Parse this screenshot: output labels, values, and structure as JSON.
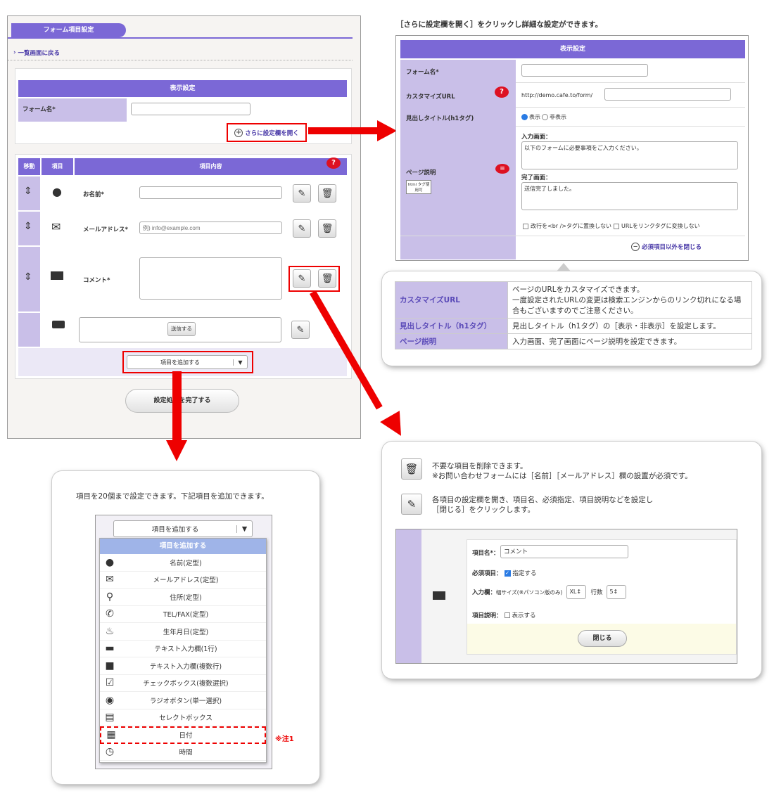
{
  "left_panel": {
    "tab_title": "フォーム項目設定",
    "back_link": "一覧画面に戻る",
    "display_header": "表示設定",
    "form_name_label": "フォーム名*",
    "open_more_label": "さらに設定欄を開く",
    "col_move": "移動",
    "col_item": "項目",
    "col_content": "項目内容",
    "rows": [
      {
        "label": "お名前*",
        "placeholder": ""
      },
      {
        "label": "メールアドレス*",
        "placeholder": "例) info@example.com"
      },
      {
        "label": "コメント*"
      }
    ],
    "submit_label": "送信する",
    "add_select": "項目を追加する",
    "complete_button": "設定処理を完了する"
  },
  "right_panel": {
    "caption": "［さらに設定欄を開く］をクリックし詳細な設定ができます。",
    "header": "表示設定",
    "form_name": "フォーム名*",
    "customize_url": "カスタマイズURL",
    "url_prefix": "http://demo.cafe.to/form/",
    "heading_title": "見出しタイトル(h1タグ)",
    "show": "表示",
    "hide": "非表示",
    "page_desc": "ページ説明",
    "html_tag": "html タグ使用可",
    "input_screen": "入力画面：",
    "input_text": "以下のフォームに必要事項をご入力ください。",
    "done_screen": "完了画面：",
    "done_text": "送信完了しました。",
    "opt_br": "改行を<br />タグに置換しない",
    "opt_url": "URLをリンクタグに変換しない",
    "close_link": "必須項目以外を閉じる"
  },
  "info_table": [
    {
      "k": "カスタマイズURL",
      "v": "ページのURLをカスタマイズできます。\n一度設定されたURLの変更は検索エンジンからのリンク切れになる場合もございますのでご注意ください。"
    },
    {
      "k": "見出しタイトル（h1タグ）",
      "v": "見出しタイトル（h1タグ）の［表示・非表示］を設定します。"
    },
    {
      "k": "ページ説明",
      "v": "入力画面、完了画面にページ説明を設定できます。"
    }
  ],
  "bottom_right": {
    "trash_text1": "不要な項目を削除できます。",
    "trash_text2": "※お問い合わせフォームには［名前］［メールアドレス］欄の設置が必須です。",
    "edit_text1": "各項目の設定欄を開き、項目名、必須指定、項目説明などを設定し",
    "edit_text2": "［閉じる］をクリックします。",
    "item_name_label": "項目名*：",
    "item_name_value": "コメント",
    "required_label": "必須項目：",
    "required_check": "指定する",
    "input_label": "入力欄：",
    "width_label": "幅サイズ(※パソコン版のみ)",
    "width_value": "XL",
    "rows_label": "行数",
    "rows_value": "5",
    "desc_label": "項目説明：",
    "desc_check": "表示する",
    "close_button": "閉じる"
  },
  "bottom_left": {
    "caption": "項目を20個まで設定できます。下記項目を追加できます。",
    "select_label": "項目を追加する",
    "list_header": "項目を追加する",
    "items": [
      "名前(定型)",
      "メールアドレス(定型)",
      "住所(定型)",
      "TEL/FAX(定型)",
      "生年月日(定型)",
      "テキスト入力欄(1行)",
      "テキスト入力欄(複数行)",
      "チェックボックス(複数選択)",
      "ラジオボタン(単一選択)",
      "セレクトボックス",
      "日付",
      "時間"
    ],
    "note": "※注1"
  }
}
